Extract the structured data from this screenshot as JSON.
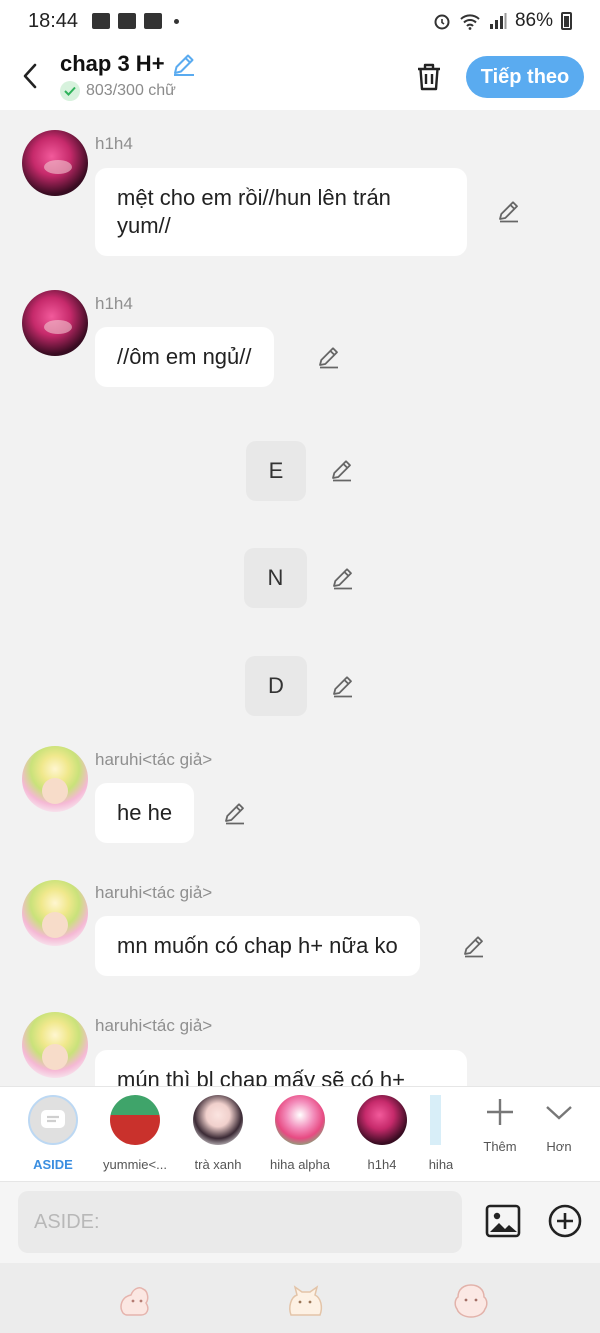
{
  "status_bar": {
    "time": "18:44",
    "battery": "86%"
  },
  "header": {
    "title": "chap 3 H+",
    "word_count": "803/300 chữ",
    "next_label": "Tiếp theo"
  },
  "messages": [
    {
      "sender": "h1h4",
      "text": "mệt cho em rồi//hun lên trán yum//"
    },
    {
      "sender": "h1h4",
      "text": "//ôm em ngủ//"
    },
    {
      "text": "E"
    },
    {
      "text": "N"
    },
    {
      "text": "D"
    },
    {
      "sender": "haruhi<tác giả>",
      "text": "he he"
    },
    {
      "sender": "haruhi<tác giả>",
      "text": "mn muốn có chap h+ nữa ko"
    },
    {
      "sender": "haruhi<tác giả>",
      "text": "mún thì bl chap mấy sẽ có h+"
    }
  ],
  "characters": [
    {
      "label": "ASIDE"
    },
    {
      "label": "yummie<..."
    },
    {
      "label": "trà xanh"
    },
    {
      "label": "hiha alpha"
    },
    {
      "label": "h1h4"
    },
    {
      "label": "hiha"
    }
  ],
  "tools": {
    "add_label": "Thêm",
    "more_label": "Hơn"
  },
  "input": {
    "placeholder": "ASIDE:"
  },
  "colors": {
    "accent": "#5aabf0",
    "aside": "#3a8ee0"
  }
}
